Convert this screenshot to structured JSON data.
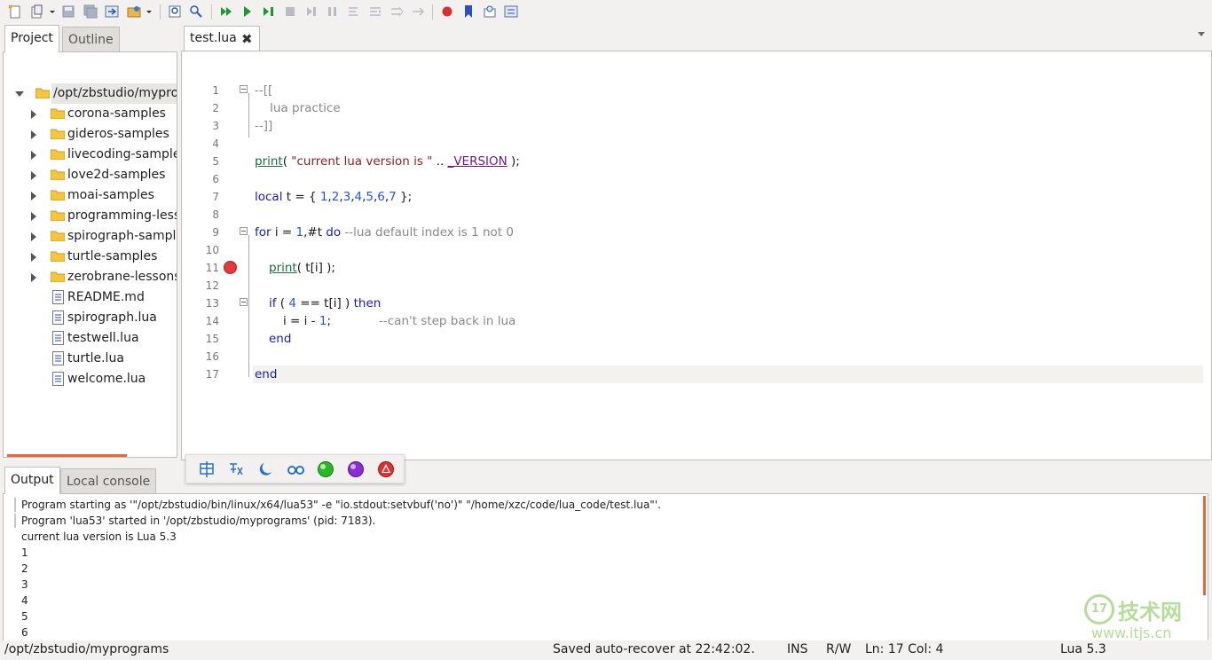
{
  "toolbar": {
    "icons": [
      "new-file-icon",
      "open-file-icon",
      "save-icon",
      "save-all-icon",
      "project-dir-icon",
      "recent-icon",
      "find-icon",
      "replace-icon",
      "run-icon",
      "run-now-icon",
      "debug-step-icon",
      "stop-icon",
      "step-over-icon",
      "step-into-icon",
      "step-out-icon",
      "break-icon",
      "continue-icon",
      "toggle-breakpoint-icon",
      "bookmark-icon",
      "watch-icon",
      "stack-icon"
    ]
  },
  "left_panel": {
    "tabs": [
      {
        "label": "Project"
      },
      {
        "label": "Outline"
      }
    ],
    "tree": [
      {
        "label": "/opt/zbstudio/myprograms",
        "type": "root"
      },
      {
        "label": "corona-samples",
        "type": "folder"
      },
      {
        "label": "gideros-samples",
        "type": "folder"
      },
      {
        "label": "livecoding-samples",
        "type": "folder"
      },
      {
        "label": "love2d-samples",
        "type": "folder"
      },
      {
        "label": "moai-samples",
        "type": "folder"
      },
      {
        "label": "programming-lessons",
        "type": "folder"
      },
      {
        "label": "spirograph-samples",
        "type": "folder"
      },
      {
        "label": "turtle-samples",
        "type": "folder"
      },
      {
        "label": "zerobrane-lessons",
        "type": "folder"
      },
      {
        "label": "README.md",
        "type": "file"
      },
      {
        "label": "spirograph.lua",
        "type": "file"
      },
      {
        "label": "testwell.lua",
        "type": "file"
      },
      {
        "label": "turtle.lua",
        "type": "file"
      },
      {
        "label": "welcome.lua",
        "type": "file"
      }
    ]
  },
  "editor": {
    "tab_label": "test.lua",
    "close_glyph": "✖",
    "line_numbers": [
      "1",
      "2",
      "3",
      "4",
      "5",
      "6",
      "7",
      "8",
      "9",
      "10",
      "11",
      "12",
      "13",
      "14",
      "15",
      "16",
      "17"
    ],
    "lines": {
      "l1": "--[[",
      "l2": "    lua practice",
      "l3": "--]]",
      "l5_fn": "print",
      "l5_a": "( ",
      "l5_str": "\"current lua version is \"",
      "l5_b": " .. ",
      "l5_glob": "_VERSION",
      "l5_c": " );",
      "l7_kw": "local",
      "l7_a": " t = { ",
      "l7_nums": [
        "1",
        "2",
        "3",
        "4",
        "5",
        "6",
        "7"
      ],
      "l7_b": " };",
      "l9_kw1": "for",
      "l9_a": " i = ",
      "l9_n": "1",
      "l9_b": ",#t ",
      "l9_kw2": "do",
      "l9_cmt": " --lua default index is 1 not 0",
      "l11_fn": "print",
      "l11_a": "( t[i] );",
      "l13_kw1": "if",
      "l13_a": " ( ",
      "l13_n": "4",
      "l13_b": " == t[i] ) ",
      "l13_kw2": "then",
      "l14_a": "i = i - ",
      "l14_n": "1",
      "l14_b": ";",
      "l14_cmt": "--can't step back in lua",
      "l15_kw": "end",
      "l17_kw": "end"
    }
  },
  "bottom_panel": {
    "tabs": [
      {
        "label": "Output"
      },
      {
        "label": "Local console"
      }
    ],
    "output_lines": [
      "Program starting as '\"/opt/zbstudio/bin/linux/x64/lua53\" -e \"io.stdout:setvbuf('no')\" \"/home/xzc/code/lua_code/test.lua\"'.",
      "Program 'lua53' started in '/opt/zbstudio/myprograms' (pid: 7183).",
      "current lua version is Lua 5.3",
      "1",
      "2",
      "3",
      "4",
      "5",
      "6"
    ]
  },
  "floating_toolbar": {
    "icons": [
      "chinese-input-icon",
      "punctuation-icon",
      "moon-icon",
      "glasses-icon",
      "green-circle-icon",
      "purple-circle-icon",
      "red-triangle-icon"
    ],
    "colors": {
      "accent": "#e4683a"
    }
  },
  "watermark": {
    "circle_text": "17",
    "brand": "技术网",
    "site": "www.itjs.cn"
  },
  "status_bar": {
    "path": "/opt/zbstudio/myprograms",
    "message": "Saved auto-recover at 22:42:02.",
    "mode": "INS",
    "access": "R/W",
    "position": "Ln: 17 Col: 4",
    "interpreter": "Lua 5.3"
  }
}
